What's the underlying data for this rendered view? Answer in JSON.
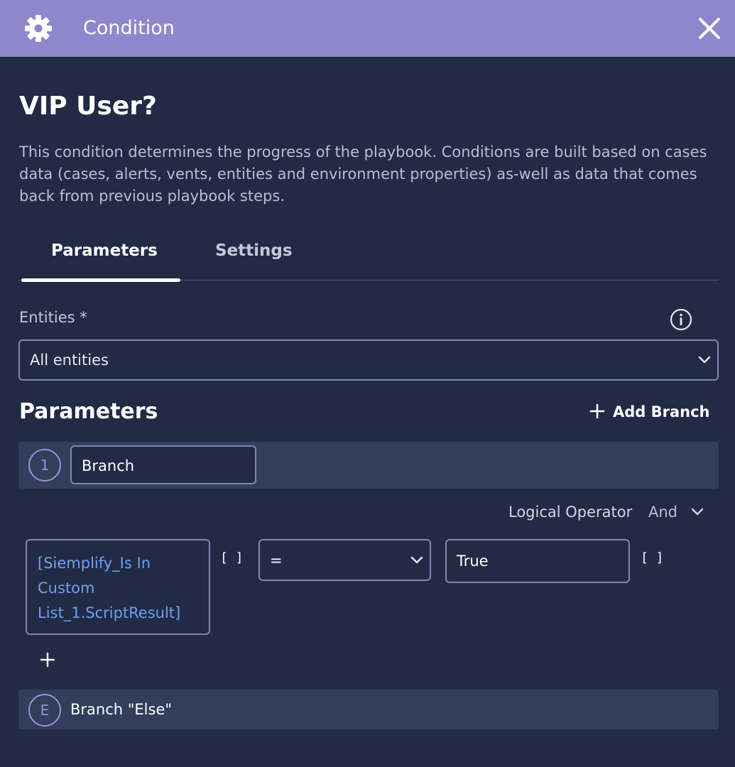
{
  "header": {
    "title": "Condition",
    "icon": "gear-icon",
    "close_icon": "close-icon",
    "background": "#8f86cc"
  },
  "main": {
    "title": "VIP User?",
    "description": "This condition determines the progress of the playbook. Conditions are built based on cases data (cases, alerts, vents, entities and environment properties) as-well as data that comes back from previous playbook steps.",
    "tabs": [
      {
        "label": "Parameters",
        "active": true
      },
      {
        "label": "Settings",
        "active": false
      }
    ]
  },
  "entities": {
    "label": "Entities *",
    "selected": "All entities",
    "info_icon": "info-icon"
  },
  "parameters": {
    "title": "Parameters",
    "add_branch_label": "Add Branch",
    "branch": {
      "number": "1",
      "name": "Branch"
    },
    "logical_operator_label": "Logical Operator",
    "logical_operator_value": "And",
    "condition": {
      "left_operand": "[Siemplify_Is In Custom List_1.ScriptResult]",
      "left_bracket": "[ ]",
      "operator": "=",
      "right_operand": "True",
      "right_bracket": "[ ]"
    },
    "else_branch": {
      "letter": "E",
      "label": "Branch \"Else\""
    }
  },
  "colors": {
    "background": "#212b45",
    "row_background": "#323e5c",
    "accent": "#9a8fd6",
    "link": "#6f9ff0",
    "border": "#7f88b5"
  }
}
